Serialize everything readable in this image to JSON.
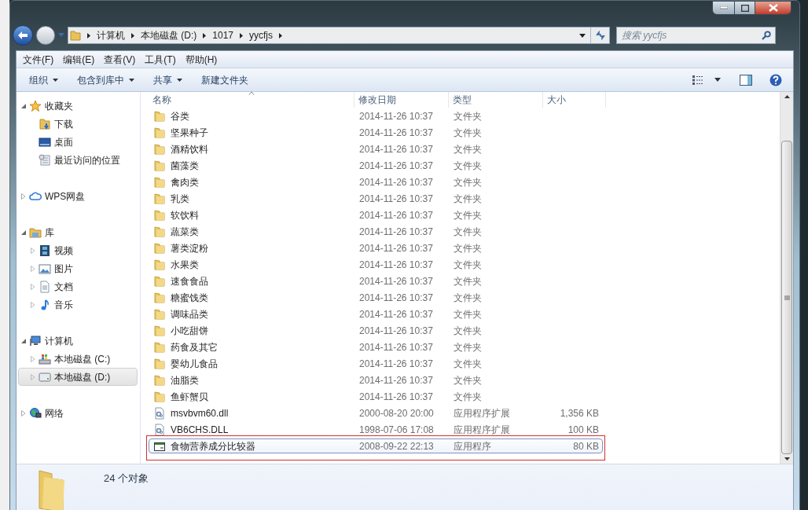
{
  "address": {
    "crumbs": [
      "计算机",
      "本地磁盘 (D:)",
      "1017",
      "yycfjs"
    ]
  },
  "search": {
    "placeholder": "搜索 yycfjs"
  },
  "menu": [
    "文件(F)",
    "编辑(E)",
    "查看(V)",
    "工具(T)",
    "帮助(H)"
  ],
  "toolbar": [
    {
      "label": "组织",
      "has_menu": true
    },
    {
      "label": "包含到库中",
      "has_menu": true
    },
    {
      "label": "共享",
      "has_menu": true
    },
    {
      "label": "新建文件夹",
      "has_menu": false
    }
  ],
  "sidebar": {
    "groups": [
      {
        "label": "收藏夹",
        "expanded": true,
        "children": [
          {
            "label": "下载",
            "expandable": false,
            "selected": false
          },
          {
            "label": "桌面",
            "expandable": false,
            "selected": false
          },
          {
            "label": "最近访问的位置",
            "expandable": false,
            "selected": false
          }
        ]
      },
      {
        "label": "WPS网盘",
        "expanded": false
      },
      {
        "label": "库",
        "expanded": true,
        "children": [
          {
            "label": "视频",
            "expandable": true,
            "selected": false
          },
          {
            "label": "图片",
            "expandable": true,
            "selected": false
          },
          {
            "label": "文档",
            "expandable": true,
            "selected": false
          },
          {
            "label": "音乐",
            "expandable": true,
            "selected": false
          }
        ]
      },
      {
        "label": "计算机",
        "expanded": true,
        "children": [
          {
            "label": "本地磁盘 (C:)",
            "expandable": true,
            "selected": false
          },
          {
            "label": "本地磁盘 (D:)",
            "expandable": true,
            "selected": true
          }
        ]
      },
      {
        "label": "网络",
        "expanded": false
      }
    ]
  },
  "table": {
    "columns": [
      {
        "label": "名称",
        "sorted": true
      },
      {
        "label": "修改日期",
        "sorted": false
      },
      {
        "label": "类型",
        "sorted": false
      },
      {
        "label": "大小",
        "sorted": false
      }
    ],
    "rows": [
      {
        "kind": "folder",
        "name": "谷类",
        "date": "2014-11-26 10:37",
        "type": "文件夹",
        "selected": false
      },
      {
        "kind": "folder",
        "name": "坚果种子",
        "date": "2014-11-26 10:37",
        "type": "文件夹",
        "selected": false
      },
      {
        "kind": "folder",
        "name": "酒精饮料",
        "date": "2014-11-26 10:37",
        "type": "文件夹",
        "selected": false
      },
      {
        "kind": "folder",
        "name": "菌藻类",
        "date": "2014-11-26 10:37",
        "type": "文件夹",
        "selected": false
      },
      {
        "kind": "folder",
        "name": "禽肉类",
        "date": "2014-11-26 10:37",
        "type": "文件夹",
        "selected": false
      },
      {
        "kind": "folder",
        "name": "乳类",
        "date": "2014-11-26 10:37",
        "type": "文件夹",
        "selected": false
      },
      {
        "kind": "folder",
        "name": "软饮料",
        "date": "2014-11-26 10:37",
        "type": "文件夹",
        "selected": false
      },
      {
        "kind": "folder",
        "name": "蔬菜类",
        "date": "2014-11-26 10:37",
        "type": "文件夹",
        "selected": false
      },
      {
        "kind": "folder",
        "name": "薯类淀粉",
        "date": "2014-11-26 10:37",
        "type": "文件夹",
        "selected": false
      },
      {
        "kind": "folder",
        "name": "水果类",
        "date": "2014-11-26 10:37",
        "type": "文件夹",
        "selected": false
      },
      {
        "kind": "folder",
        "name": "速食食品",
        "date": "2014-11-26 10:37",
        "type": "文件夹",
        "selected": false
      },
      {
        "kind": "folder",
        "name": "糖蜜饯类",
        "date": "2014-11-26 10:37",
        "type": "文件夹",
        "selected": false
      },
      {
        "kind": "folder",
        "name": "调味品类",
        "date": "2014-11-26 10:37",
        "type": "文件夹",
        "selected": false
      },
      {
        "kind": "folder",
        "name": "小吃甜饼",
        "date": "2014-11-26 10:37",
        "type": "文件夹",
        "selected": false
      },
      {
        "kind": "folder",
        "name": "药食及其它",
        "date": "2014-11-26 10:37",
        "type": "文件夹",
        "selected": false
      },
      {
        "kind": "folder",
        "name": "婴幼儿食品",
        "date": "2014-11-26 10:37",
        "type": "文件夹",
        "selected": false
      },
      {
        "kind": "folder",
        "name": "油脂类",
        "date": "2014-11-26 10:37",
        "type": "文件夹",
        "selected": false
      },
      {
        "kind": "folder",
        "name": "鱼虾蟹贝",
        "date": "2014-11-26 10:37",
        "type": "文件夹",
        "selected": false
      },
      {
        "kind": "dll",
        "name": "msvbvm60.dll",
        "date": "2000-08-20 20:00",
        "type": "应用程序扩展",
        "size": "1,356 KB",
        "selected": false
      },
      {
        "kind": "dll",
        "name": "VB6CHS.DLL",
        "date": "1998-07-06 17:08",
        "type": "应用程序扩展",
        "size": "100 KB",
        "selected": false
      },
      {
        "kind": "exe",
        "name": "食物营养成分比较器",
        "date": "2008-09-22 22:13",
        "type": "应用程序",
        "size": "80 KB",
        "selected": true,
        "annotated": true
      }
    ]
  },
  "status_bar": {
    "count": "24 个对象"
  }
}
